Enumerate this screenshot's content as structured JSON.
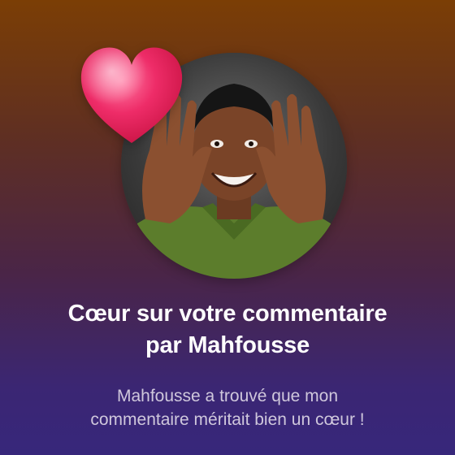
{
  "notification": {
    "title_line1": "Cœur sur votre commentaire",
    "title_line2": "par Mahfousse",
    "body_line1": "Mahfousse a trouvé que mon",
    "body_line2": "commentaire méritait bien un cœur !"
  },
  "icons": {
    "heart": "heart-icon",
    "avatar": "user-avatar"
  },
  "colors": {
    "background_top": "#7b3e05",
    "background_bottom": "#37277b",
    "title": "#ffffff",
    "body": "#cfc7dc",
    "heart": "#e8245f"
  }
}
